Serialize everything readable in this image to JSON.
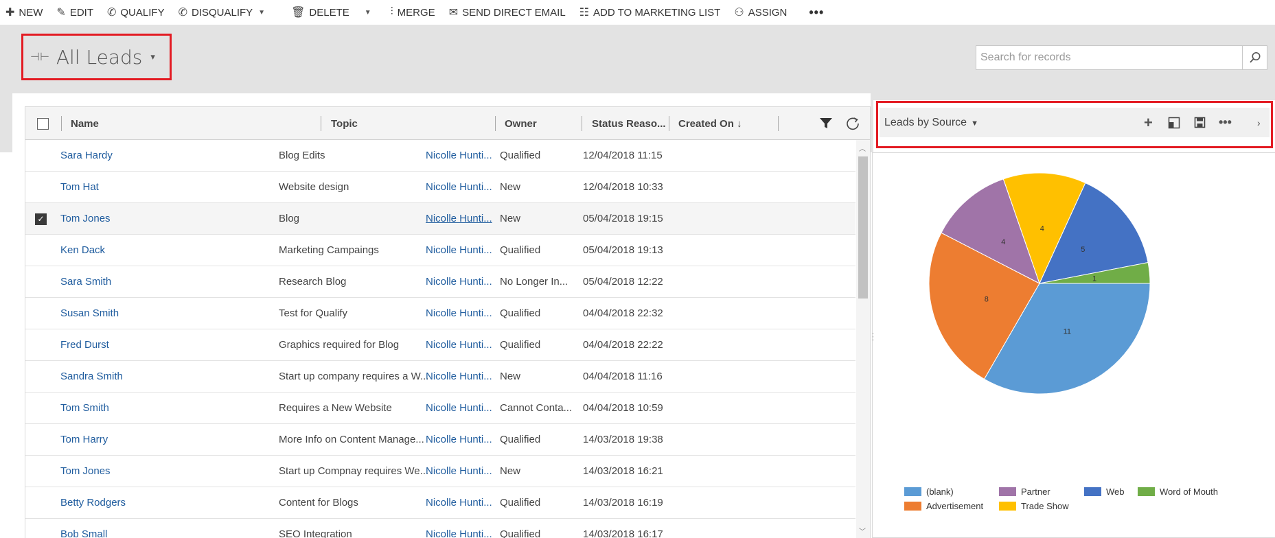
{
  "commandbar": {
    "items": [
      {
        "label": "NEW",
        "icon": "plus-icon"
      },
      {
        "label": "EDIT",
        "icon": "pencil-icon"
      },
      {
        "label": "QUALIFY",
        "icon": "phone-check-icon"
      },
      {
        "label": "DISQUALIFY",
        "icon": "phone-cross-icon"
      },
      {
        "label": "DELETE",
        "icon": "trash-icon"
      },
      {
        "label": "MERGE",
        "icon": "merge-icon"
      },
      {
        "label": "SEND DIRECT EMAIL",
        "icon": "envelope-icon"
      },
      {
        "label": "ADD TO MARKETING LIST",
        "icon": "list-icon"
      },
      {
        "label": "ASSIGN",
        "icon": "people-icon"
      }
    ],
    "more": "•••"
  },
  "view": {
    "title": "All Leads",
    "caret": "⌄"
  },
  "search": {
    "placeholder": "Search for records"
  },
  "grid": {
    "columns": [
      "Name",
      "Topic",
      "Owner",
      "Status Reaso...",
      "Created On ↓"
    ],
    "rows": [
      {
        "name": "Sara Hardy",
        "topic": "Blog Edits",
        "owner": "Nicolle Hunti...",
        "status": "Qualified",
        "created": "12/04/2018 11:15",
        "selected": false
      },
      {
        "name": "Tom Hat",
        "topic": "Website design",
        "owner": "Nicolle Hunti...",
        "status": "New",
        "created": "12/04/2018 10:33",
        "selected": false
      },
      {
        "name": "Tom Jones",
        "topic": "Blog",
        "owner": "Nicolle Hunti...",
        "status": "New",
        "created": "05/04/2018 19:15",
        "selected": true
      },
      {
        "name": "Ken Dack",
        "topic": "Marketing Campaings",
        "owner": "Nicolle Hunti...",
        "status": "Qualified",
        "created": "05/04/2018 19:13",
        "selected": false
      },
      {
        "name": "Sara Smith",
        "topic": "Research Blog",
        "owner": "Nicolle Hunti...",
        "status": "No Longer In...",
        "created": "05/04/2018 12:22",
        "selected": false
      },
      {
        "name": "Susan Smith",
        "topic": "Test for Qualify",
        "owner": "Nicolle Hunti...",
        "status": "Qualified",
        "created": "04/04/2018 22:32",
        "selected": false
      },
      {
        "name": "Fred Durst",
        "topic": "Graphics required for Blog",
        "owner": "Nicolle Hunti...",
        "status": "Qualified",
        "created": "04/04/2018 22:22",
        "selected": false
      },
      {
        "name": "Sandra Smith",
        "topic": "Start up company requires a W...",
        "owner": "Nicolle Hunti...",
        "status": "New",
        "created": "04/04/2018 11:16",
        "selected": false
      },
      {
        "name": "Tom Smith",
        "topic": "Requires a New Website",
        "owner": "Nicolle Hunti...",
        "status": "Cannot Conta...",
        "created": "04/04/2018 10:59",
        "selected": false
      },
      {
        "name": "Tom Harry",
        "topic": "More Info on Content Manage...",
        "owner": "Nicolle Hunti...",
        "status": "Qualified",
        "created": "14/03/2018 19:38",
        "selected": false
      },
      {
        "name": "Tom Jones",
        "topic": "Start up Compnay requires We...",
        "owner": "Nicolle Hunti...",
        "status": "New",
        "created": "14/03/2018 16:21",
        "selected": false
      },
      {
        "name": "Betty Rodgers",
        "topic": "Content for Blogs",
        "owner": "Nicolle Hunti...",
        "status": "Qualified",
        "created": "14/03/2018 16:19",
        "selected": false
      },
      {
        "name": "Bob Small",
        "topic": "SEO Integration",
        "owner": "Nicolle Hunti...",
        "status": "Qualified",
        "created": "14/03/2018 16:17",
        "selected": false
      }
    ]
  },
  "chart_panel": {
    "title": "Leads by Source",
    "caret": "⌄",
    "toolbar_icons": [
      "plus-icon",
      "expand-icon",
      "save-icon",
      "more-icon",
      "chevron-right-icon"
    ]
  },
  "chart_data": {
    "type": "pie",
    "slices": [
      {
        "label": "(blank)",
        "value": 11,
        "color": "#5b9bd5"
      },
      {
        "label": "Advertisement",
        "value": 8,
        "color": "#ed7d31"
      },
      {
        "label": "Partner",
        "value": 4,
        "color": "#a074a8"
      },
      {
        "label": "Trade Show",
        "value": 4,
        "color": "#ffc000"
      },
      {
        "label": "Web",
        "value": 5,
        "color": "#4472c4"
      },
      {
        "label": "Word of Mouth",
        "value": 1,
        "color": "#70ad47"
      }
    ],
    "legend": [
      "(blank)",
      "Partner",
      "Web",
      "Word of Mouth",
      "Advertisement",
      "Trade Show"
    ],
    "legend_position": "bottom"
  }
}
